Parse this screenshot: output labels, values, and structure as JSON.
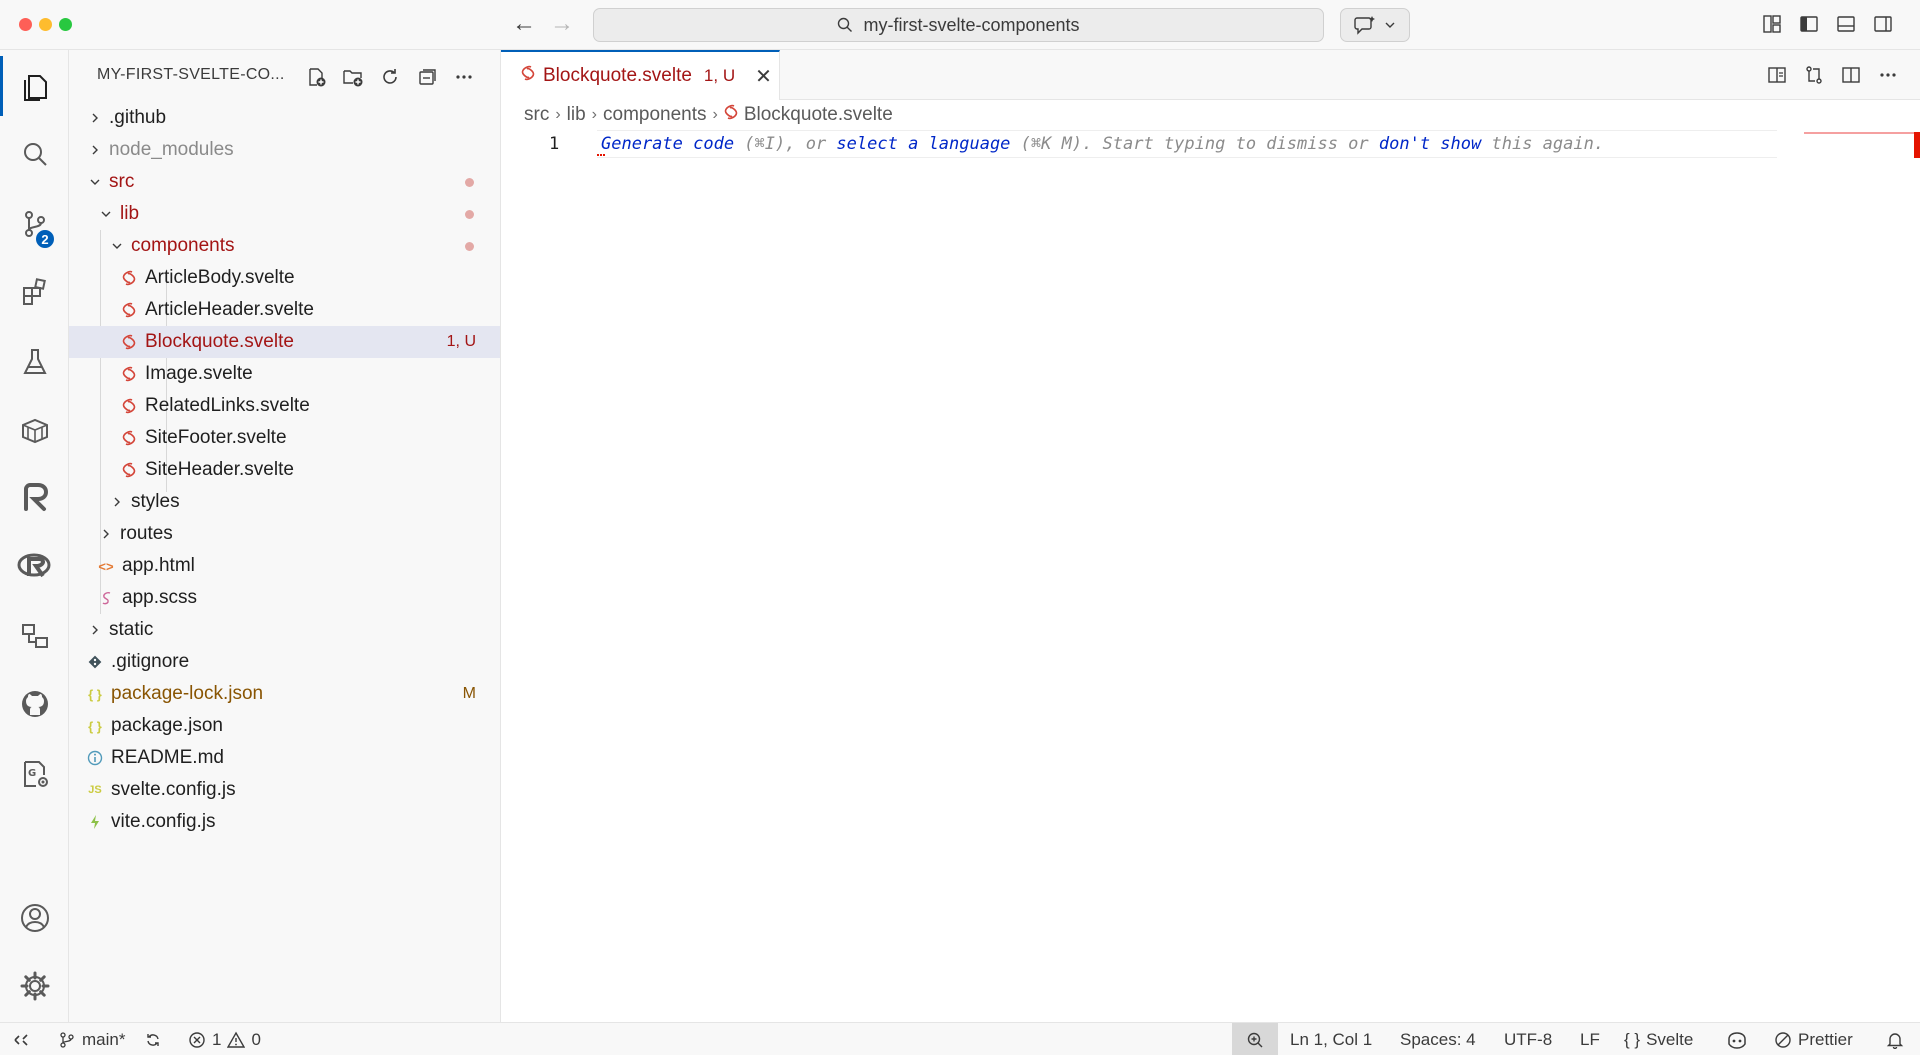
{
  "window": {
    "title": "my-first-svelte-components"
  },
  "sidebar": {
    "header": "MY-FIRST-SVELTE-CO...",
    "tree": [
      {
        "label": ".github",
        "type": "folder",
        "expanded": false,
        "depth": 0
      },
      {
        "label": "node_modules",
        "type": "folder",
        "expanded": false,
        "depth": 0,
        "dimmed": true
      },
      {
        "label": "src",
        "type": "folder",
        "expanded": true,
        "depth": 0,
        "decoration": "dot"
      },
      {
        "label": "lib",
        "type": "folder",
        "expanded": true,
        "depth": 1,
        "decoration": "dot"
      },
      {
        "label": "components",
        "type": "folder",
        "expanded": true,
        "depth": 2,
        "decoration": "dot"
      },
      {
        "label": "ArticleBody.svelte",
        "type": "svelte",
        "depth": 3
      },
      {
        "label": "ArticleHeader.svelte",
        "type": "svelte",
        "depth": 3
      },
      {
        "label": "Blockquote.svelte",
        "type": "svelte",
        "depth": 3,
        "selected": true,
        "status": "1, U"
      },
      {
        "label": "Image.svelte",
        "type": "svelte",
        "depth": 3
      },
      {
        "label": "RelatedLinks.svelte",
        "type": "svelte",
        "depth": 3
      },
      {
        "label": "SiteFooter.svelte",
        "type": "svelte",
        "depth": 3
      },
      {
        "label": "SiteHeader.svelte",
        "type": "svelte",
        "depth": 3
      },
      {
        "label": "styles",
        "type": "folder",
        "expanded": false,
        "depth": 2
      },
      {
        "label": "routes",
        "type": "folder",
        "expanded": false,
        "depth": 1
      },
      {
        "label": "app.html",
        "type": "html",
        "depth": 1
      },
      {
        "label": "app.scss",
        "type": "scss",
        "depth": 1
      },
      {
        "label": "static",
        "type": "folder",
        "expanded": false,
        "depth": 0
      },
      {
        "label": ".gitignore",
        "type": "git",
        "depth": 0
      },
      {
        "label": "package-lock.json",
        "type": "json",
        "depth": 0,
        "status": "M"
      },
      {
        "label": "package.json",
        "type": "json",
        "depth": 0
      },
      {
        "label": "README.md",
        "type": "info",
        "depth": 0
      },
      {
        "label": "svelte.config.js",
        "type": "js",
        "depth": 0
      },
      {
        "label": "vite.config.js",
        "type": "vite",
        "depth": 0
      }
    ]
  },
  "activitybar": {
    "scm_badge": "2"
  },
  "editor": {
    "tab": {
      "label": "Blockquote.svelte",
      "status": "1, U"
    },
    "breadcrumb": [
      "src",
      "lib",
      "components",
      "Blockquote.svelte"
    ],
    "line_number": "1",
    "hint": {
      "generate": "Generate code",
      "part1": " (⌘I), or ",
      "select": "select a language",
      "part2": " (⌘K M). Start typing to dismiss or ",
      "dontshow": "don't show",
      "part3": " this again."
    }
  },
  "statusbar": {
    "branch": "main*",
    "errors": "1",
    "warnings": "0",
    "position": "Ln 1, Col 1",
    "spaces": "Spaces: 4",
    "encoding": "UTF-8",
    "eol": "LF",
    "language_braces": "{ }",
    "language": "Svelte",
    "prettier": "Prettier"
  },
  "colors": {
    "accent": "#005fb8",
    "error": "#e51400",
    "git_untracked_text": "#a31515",
    "git_modified_text": "#895503",
    "svelte_icon": "#d4463a"
  }
}
